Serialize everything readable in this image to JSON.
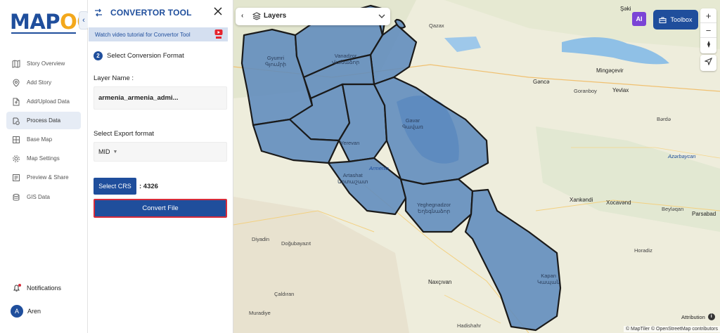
{
  "nav": {
    "logo_left": "MAP",
    "logo_right": "OG",
    "items": [
      {
        "label": "Story Overview",
        "icon": "map-book-icon"
      },
      {
        "label": "Add Story",
        "icon": "location-pin-icon"
      },
      {
        "label": "Add/Upload Data",
        "icon": "file-upload-icon"
      },
      {
        "label": "Process Data",
        "icon": "process-data-icon"
      },
      {
        "label": "Base Map",
        "icon": "base-map-icon"
      },
      {
        "label": "Map Settings",
        "icon": "gear-icon"
      },
      {
        "label": "Preview & Share",
        "icon": "preview-icon"
      },
      {
        "label": "GIS Data",
        "icon": "database-icon"
      }
    ],
    "active_index": 3,
    "notifications_label": "Notifications",
    "user_initial": "A",
    "user_name": "Aren"
  },
  "panel": {
    "title": "CONVERTOR TOOL",
    "tutorial_text": "Watch video tutorial for Convertor Tool",
    "step_number": "2",
    "step_title": "Select Conversion Format",
    "layer_name_label": "Layer Name :",
    "layer_name_value": "armenia_armenia_admi...",
    "export_label": "Select Export format",
    "export_value": "MID",
    "crs_button": "Select CRS",
    "crs_value": ": 4326",
    "convert_button": "Convert File"
  },
  "map": {
    "layers_label": "Layers",
    "toolbox_label": "Toolbox",
    "ai_label": "AI",
    "attribution_label": "Attribution",
    "copyright": "© MapTiler © OpenStreetMap contributors",
    "colors": {
      "region_fill": "#5f8bbd",
      "region_stroke": "#1a1a1a",
      "base": "#eeeddc",
      "water": "#8fc0e6",
      "accent": "#1f4e9c"
    },
    "labels": [
      {
        "name": "Gyumri",
        "sub": "Գյումրի",
        "type": "arm"
      },
      {
        "name": "Vanadzor",
        "sub": "Վանաձոր",
        "type": "arm"
      },
      {
        "name": "Gavar",
        "sub": "Գավառ",
        "type": "arm"
      },
      {
        "name": "Yerevan",
        "sub": "",
        "type": "arm"
      },
      {
        "name": "Armenia",
        "sub": "",
        "type": "italic"
      },
      {
        "name": "Artashat",
        "sub": "Արտաշատ",
        "type": "arm"
      },
      {
        "name": "Yeghegnadzor",
        "sub": "Եղեգնաձոր",
        "type": "arm"
      },
      {
        "name": "Kapan",
        "sub": "Կապան",
        "type": "arm"
      },
      {
        "name": "Şəki",
        "sub": "",
        "type": "plain"
      },
      {
        "name": "Qazax",
        "sub": "",
        "type": "plain"
      },
      {
        "name": "Mingəçevir",
        "sub": "",
        "type": "big"
      },
      {
        "name": "Gəncə",
        "sub": "",
        "type": "big"
      },
      {
        "name": "Goranboy",
        "sub": "",
        "type": "plain"
      },
      {
        "name": "Yevlax",
        "sub": "",
        "type": "big"
      },
      {
        "name": "Bərdə",
        "sub": "",
        "type": "plain"
      },
      {
        "name": "Azərbaycan",
        "sub": "",
        "type": "italic"
      },
      {
        "name": "Xankəndi",
        "sub": "",
        "type": "big"
      },
      {
        "name": "Xocavənd",
        "sub": "",
        "type": "big"
      },
      {
        "name": "Beyləqan",
        "sub": "",
        "type": "plain"
      },
      {
        "name": "Parsabad",
        "sub": "",
        "type": "big"
      },
      {
        "name": "Horadiz",
        "sub": "",
        "type": "plain"
      },
      {
        "name": "Naxçıvan",
        "sub": "",
        "type": "big"
      },
      {
        "name": "Doğubayazıt",
        "sub": "",
        "type": "plain"
      },
      {
        "name": "Diyadin",
        "sub": "",
        "type": "plain"
      },
      {
        "name": "Çaldıran",
        "sub": "",
        "type": "plain"
      },
      {
        "name": "Muradiye",
        "sub": "",
        "type": "plain"
      },
      {
        "name": "Hadishahr",
        "sub": "",
        "type": "plain"
      }
    ]
  }
}
